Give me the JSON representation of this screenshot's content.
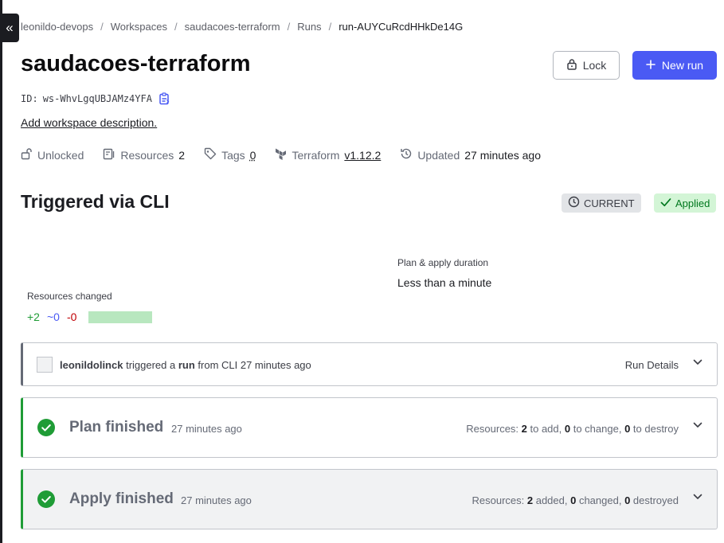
{
  "sidebar": {
    "toggle_label": "«"
  },
  "breadcrumb": [
    "leonildo-devops",
    "Workspaces",
    "saudacoes-terraform",
    "Runs",
    "run-AUYCuRcdHHkDe14G"
  ],
  "header": {
    "title": "saudacoes-terraform",
    "lock_label": "Lock",
    "new_run_label": "New run",
    "id_label": "ID:",
    "id_value": "ws-WhvLgqUBJAMz4YFA",
    "add_description": "Add workspace description."
  },
  "meta": {
    "lock_state": "Unlocked",
    "resources_label": "Resources",
    "resources_count": "2",
    "tags_label": "Tags",
    "tags_count": "0",
    "terraform_label": "Terraform",
    "terraform_version": "v1.12.2",
    "updated_label": "Updated",
    "updated_value": "27 minutes ago"
  },
  "run": {
    "title": "Triggered via CLI",
    "badge_current": "CURRENT",
    "badge_status": "Applied",
    "resources_changed_label": "Resources changed",
    "added": "+2",
    "changed": "~0",
    "destroyed": "-0",
    "duration_label": "Plan & apply duration",
    "duration_value": "Less than a minute"
  },
  "trigger": {
    "user": "leonildolinck",
    "text1": " triggered a ",
    "run_word": "run",
    "text2": " from CLI 27 minutes ago",
    "details_label": "Run Details"
  },
  "plan": {
    "title": "Plan finished",
    "time": "27 minutes ago",
    "summary_prefix": "Resources: ",
    "add_n": "2",
    "add_text": " to add, ",
    "change_n": "0",
    "change_text": " to change, ",
    "destroy_n": "0",
    "destroy_text": " to destroy"
  },
  "apply": {
    "title": "Apply finished",
    "time": "27 minutes ago",
    "summary_prefix": "Resources: ",
    "add_n": "2",
    "add_text": " added, ",
    "change_n": "0",
    "change_text": " changed, ",
    "destroy_n": "0",
    "destroy_text": " destroyed"
  },
  "colors": {
    "accent": "#4a5af4",
    "success": "#1f9c36",
    "danger": "#c00005"
  }
}
